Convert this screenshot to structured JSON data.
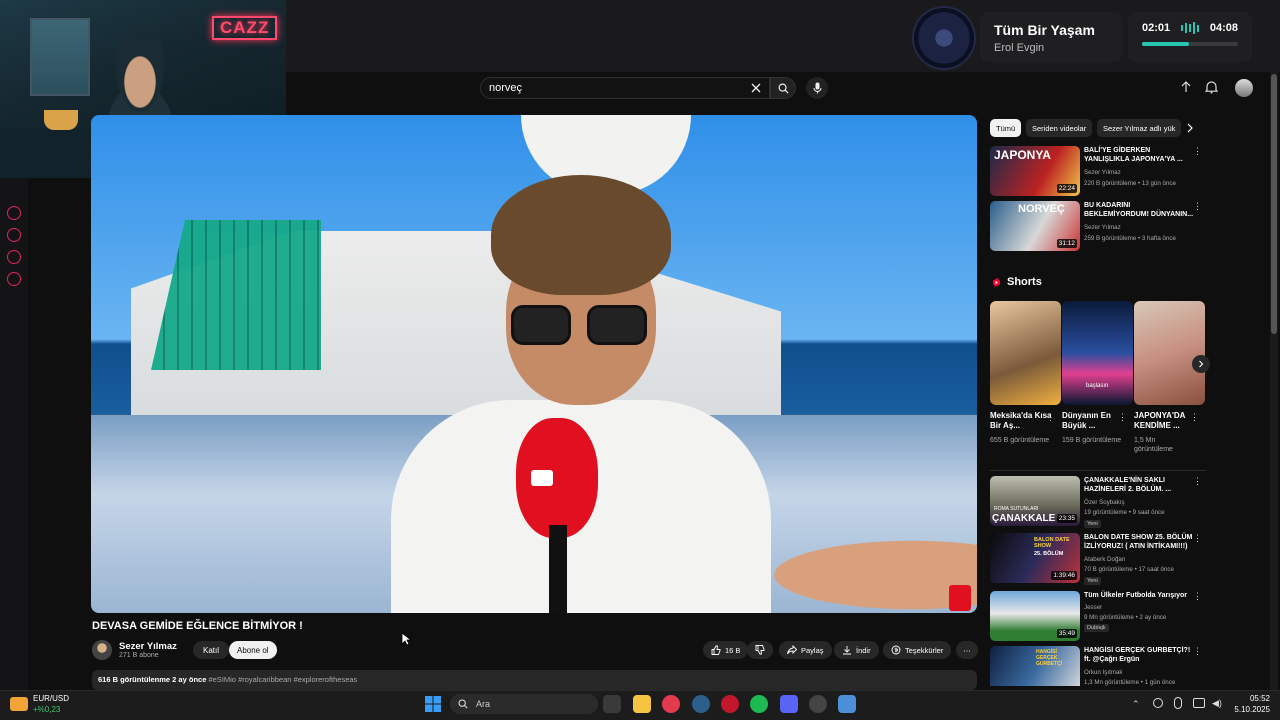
{
  "overlay": {
    "neon_sign": "CAZZ"
  },
  "music": {
    "title": "Tüm Bir Yaşam",
    "artist": "Erol Evgin",
    "elapsed": "02:01",
    "total": "04:08",
    "progress": 0.49,
    "accent": "#26c6b2"
  },
  "header": {
    "search_value": "norveç",
    "icons": [
      "close-icon",
      "search-icon",
      "mic-icon",
      "upload-icon",
      "bell-icon",
      "avatar"
    ]
  },
  "video": {
    "title": "DEVASA GEMİDE EĞLENCE BİTMİYOR !",
    "channel": "Sezer Yılmaz",
    "subscribers": "271 B abone",
    "join_label": "Katıl",
    "subscribe_label": "Abone ol",
    "likes": "16 B",
    "share_label": "Paylaş",
    "download_label": "İndir",
    "thanks_label": "Teşekkürler",
    "views_date": "616 B görüntülenme  2 ay önce",
    "hashtags": "#eSIMio #royalcaribbean #exploreroftheseas"
  },
  "sidebar": {
    "chips": [
      "Tümü",
      "Seriden videolar",
      "Sezer Yılmaz adlı yük"
    ],
    "top_recs": [
      {
        "title": "BALİ'YE GİDERKEN YANLIŞLIKLA JAPONYA'YA ...",
        "channel": "Sezer Yılmaz",
        "meta": "220 B görüntüleme • 13 gün önce",
        "duration": "22:24",
        "thumb_text": "JAPONYA"
      },
      {
        "title": "BU KADARINI BEKLEMİYORDUM! DÜNYANIN...",
        "channel": "Sezer Yılmaz",
        "meta": "259 B görüntüleme • 3 hafta önce",
        "duration": "31:12",
        "thumb_text": "NORVEÇ"
      }
    ],
    "shorts_label": "Shorts",
    "shorts": [
      {
        "title": "Meksika'da Kısa Bir Aş...",
        "views": "655 B görüntüleme"
      },
      {
        "title": "Dünyanın En Büyük ...",
        "views": "159 B görüntüleme",
        "overlay": "başlasın"
      },
      {
        "title": "JAPONYA'DA KENDİME ...",
        "views": "1,5 Mn görüntüleme"
      }
    ],
    "bottom_recs": [
      {
        "title": "ÇANAKKALE'NİN SAKLI HAZİNELERİ 2. BÖLÜM. ...",
        "channel": "Özer Soybakış",
        "meta": "19 görüntüleme • 9 saat önce",
        "duration": "23:35",
        "tag": "Yeni",
        "thumb_text": "ÇANAKKALE",
        "thumb_sub": "ROMA SUTUNLARI"
      },
      {
        "title": "BALON DATE SHOW 25. BÖLÜM İZLİYORUZ! ( ATIN İNTİKAMI!!!)",
        "channel": "Ataberk Doğan",
        "meta": "70 B görüntüleme • 17 saat önce",
        "duration": "1:39:46",
        "tag": "Yeni",
        "thumb_text": "BALON DATE SHOW",
        "thumb_sub": "25. BÖLÜM"
      },
      {
        "title": "Tüm Ülkeler Futbolda Yarışıyor",
        "channel": "Jesser",
        "meta": "9 Mn görüntüleme • 2 ay önce",
        "duration": "35:49",
        "tag": "Dublajlı"
      },
      {
        "title": "HANGİSİ GERÇEK GURBETÇİ?! ft. @Çağrı Ergün",
        "channel": "Orkun Işıtmak",
        "meta": "1,3 Mn görüntüleme • 1 gün önce",
        "duration": "",
        "tag": "",
        "thumb_text": "HANGİSİ GERÇEK GURBETÇİ"
      }
    ]
  },
  "taskbar": {
    "fx_pair": "EUR/USD",
    "fx_change": "+%0,23",
    "search_placeholder": "Ara",
    "time": "05:52",
    "date": "5.10.2025",
    "up_color": "#3cc46f"
  }
}
